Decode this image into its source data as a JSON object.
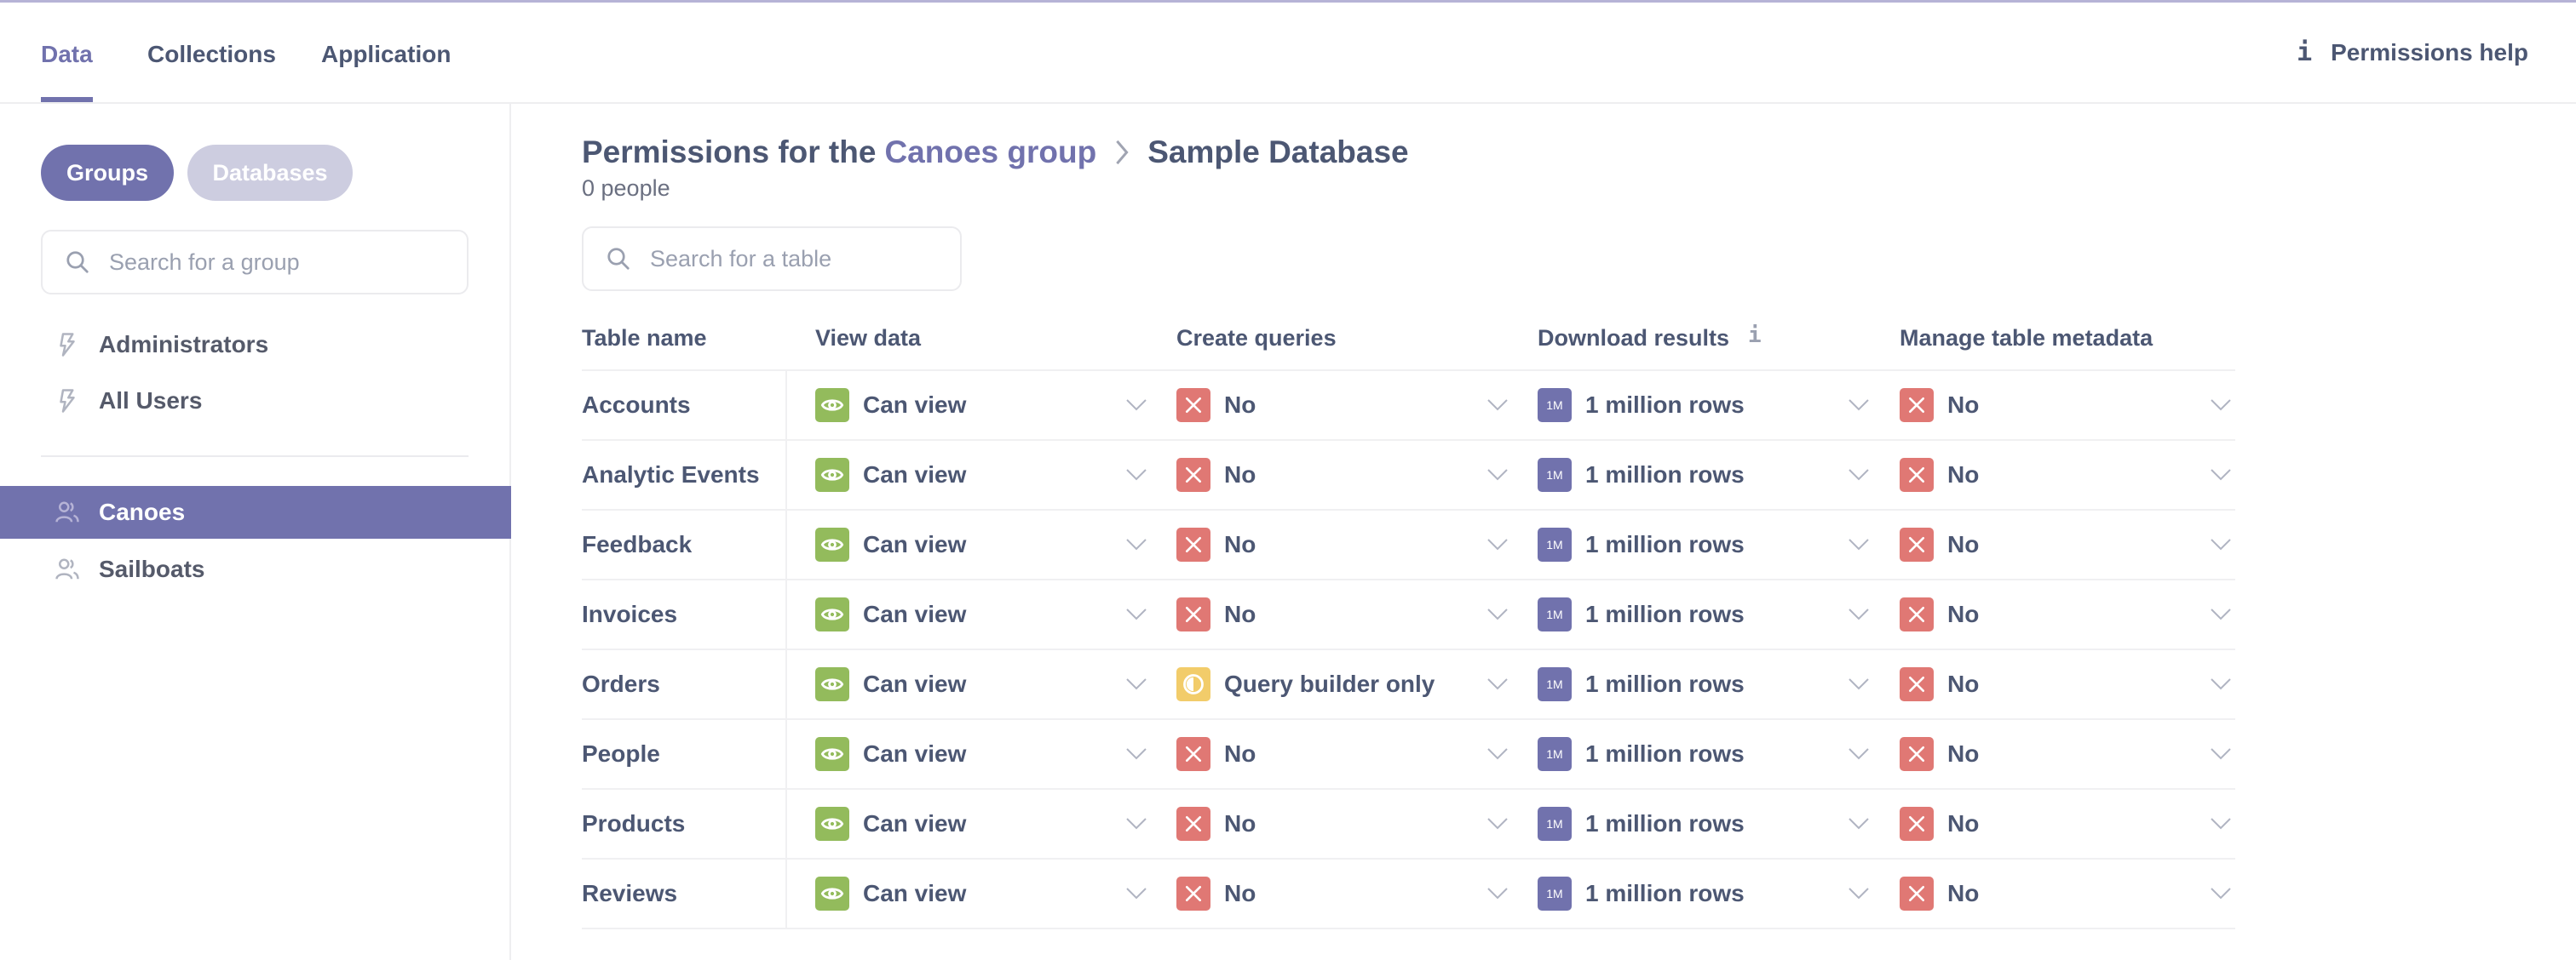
{
  "nav": {
    "tabs": [
      {
        "label": "Data",
        "active": true
      },
      {
        "label": "Collections",
        "active": false
      },
      {
        "label": "Application",
        "active": false
      }
    ],
    "help_label": "Permissions help"
  },
  "sidebar": {
    "toggle": {
      "groups_label": "Groups",
      "databases_label": "Databases",
      "selected": "Groups"
    },
    "search_placeholder": "Search for a group",
    "special_groups": [
      {
        "label": "Administrators",
        "icon": "bolt-icon"
      },
      {
        "label": "All Users",
        "icon": "bolt-icon"
      }
    ],
    "groups": [
      {
        "label": "Canoes",
        "icon": "people-icon",
        "active": true
      },
      {
        "label": "Sailboats",
        "icon": "people-icon",
        "active": false
      }
    ]
  },
  "main": {
    "heading_prefix": "Permissions for the",
    "group_link": "Canoes group",
    "database": "Sample Database",
    "people_count": "0 people",
    "search_placeholder": "Search for a table"
  },
  "table": {
    "columns": [
      "Table name",
      "View data",
      "Create queries",
      "Download results",
      "Manage table metadata"
    ],
    "status_colors": {
      "view": "#93bb5c",
      "no": "#e07874",
      "partial": "#f2cc6a",
      "download": "#7172ad"
    },
    "rows": [
      {
        "name": "Accounts",
        "view": "Can view",
        "create": "No",
        "create_kind": "no",
        "download": "1 million rows",
        "manage": "No"
      },
      {
        "name": "Analytic Events",
        "view": "Can view",
        "create": "No",
        "create_kind": "no",
        "download": "1 million rows",
        "manage": "No"
      },
      {
        "name": "Feedback",
        "view": "Can view",
        "create": "No",
        "create_kind": "no",
        "download": "1 million rows",
        "manage": "No"
      },
      {
        "name": "Invoices",
        "view": "Can view",
        "create": "No",
        "create_kind": "no",
        "download": "1 million rows",
        "manage": "No"
      },
      {
        "name": "Orders",
        "view": "Can view",
        "create": "Query builder only",
        "create_kind": "partial",
        "download": "1 million rows",
        "manage": "No"
      },
      {
        "name": "People",
        "view": "Can view",
        "create": "No",
        "create_kind": "no",
        "download": "1 million rows",
        "manage": "No"
      },
      {
        "name": "Products",
        "view": "Can view",
        "create": "No",
        "create_kind": "no",
        "download": "1 million rows",
        "manage": "No"
      },
      {
        "name": "Reviews",
        "view": "Can view",
        "create": "No",
        "create_kind": "no",
        "download": "1 million rows",
        "manage": "No"
      }
    ],
    "download_badge_text": "1M"
  }
}
